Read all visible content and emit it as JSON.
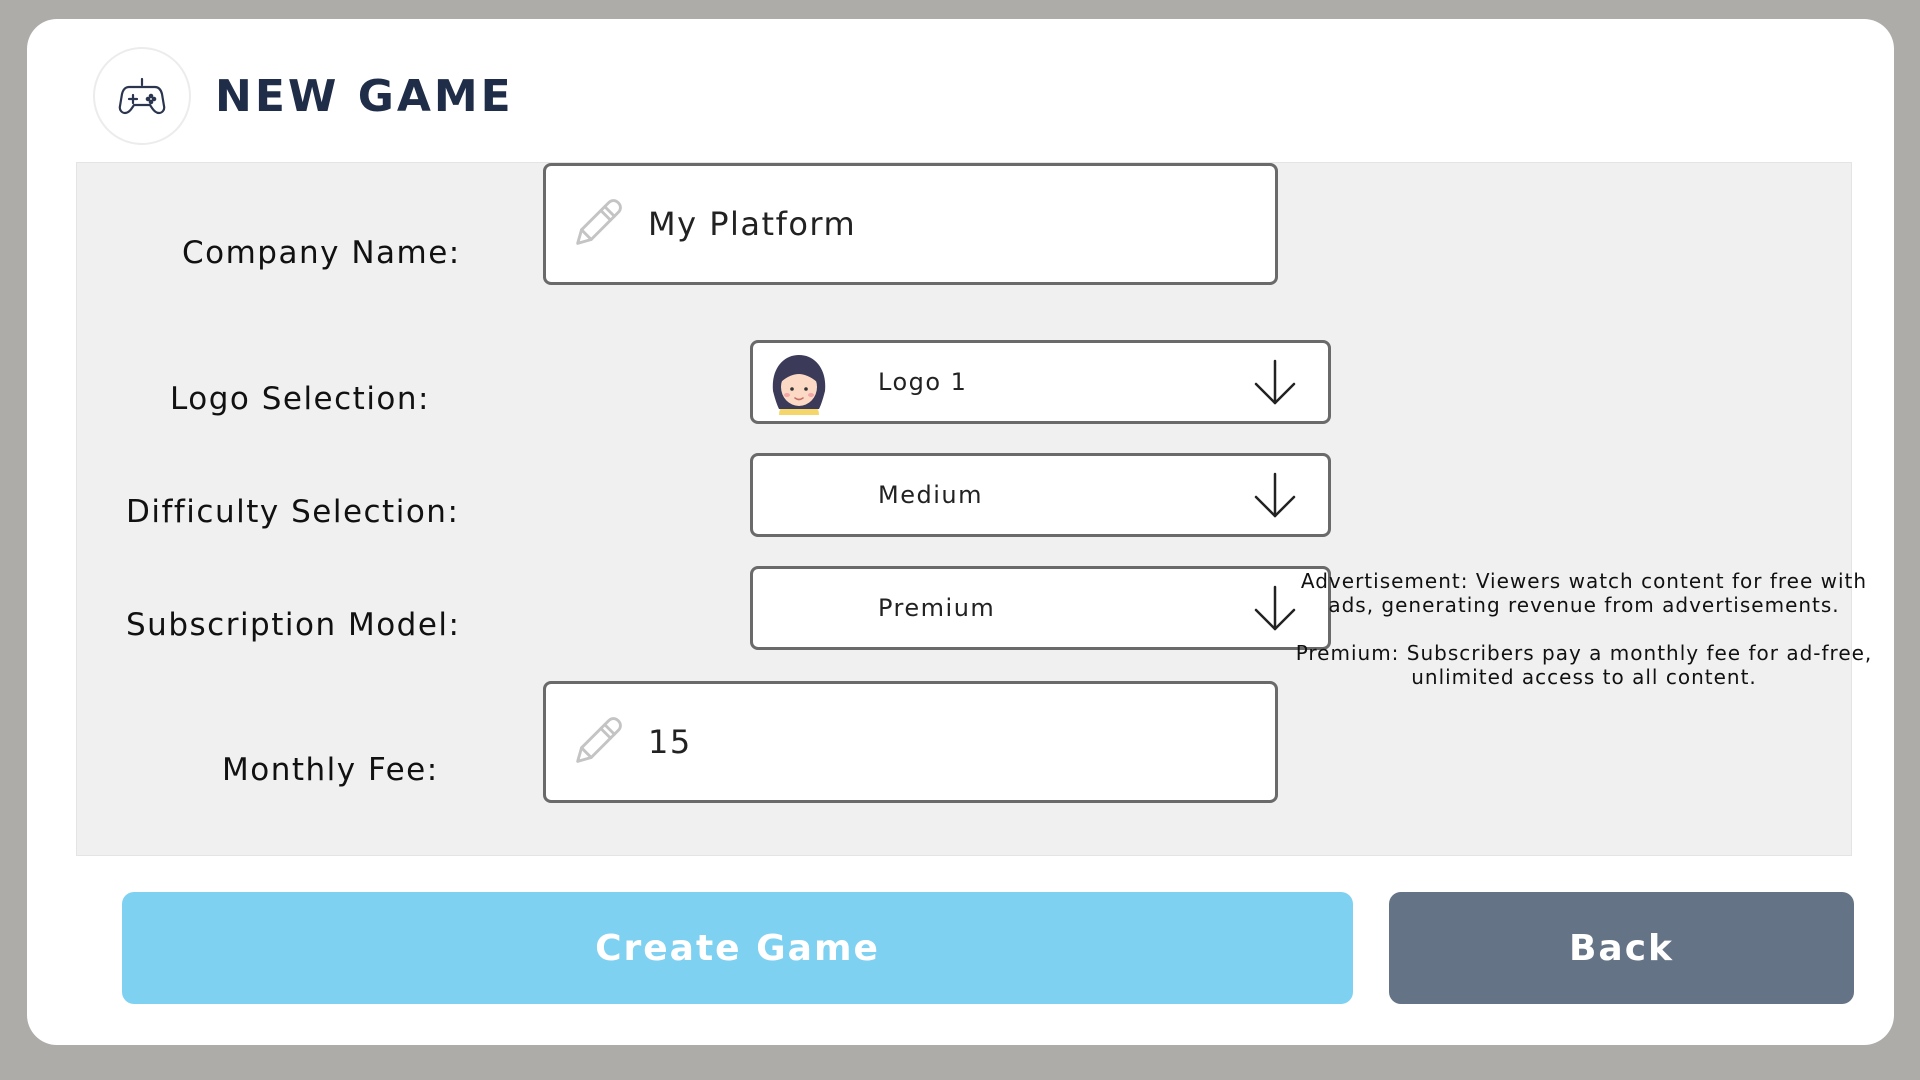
{
  "header": {
    "title": "NEW GAME",
    "icon": "gamepad-icon"
  },
  "form": {
    "company_name": {
      "label": "Company Name:",
      "value": "My Platform",
      "icon": "pencil-icon"
    },
    "logo": {
      "label": "Logo Selection:",
      "value": "Logo 1",
      "icon": "avatar-girl-icon"
    },
    "difficulty": {
      "label": "Difficulty Selection:",
      "value": "Medium"
    },
    "subscription": {
      "label": "Subscription Model:",
      "value": "Premium"
    },
    "monthly_fee": {
      "label": "Monthly Fee:",
      "value": "15",
      "icon": "pencil-icon"
    }
  },
  "info": {
    "advertisement": "Advertisement: Viewers watch content for free with ads, generating revenue from advertisements.",
    "premium": "Premium: Subscribers pay a monthly fee for ad-free, unlimited access to all content."
  },
  "buttons": {
    "create": "Create Game",
    "back": "Back"
  },
  "colors": {
    "backdrop": "#aeaca9",
    "title": "#1f2d48",
    "create_button": "#7fd1f2",
    "back_button": "#647386",
    "panel": "#f0f0f0"
  }
}
